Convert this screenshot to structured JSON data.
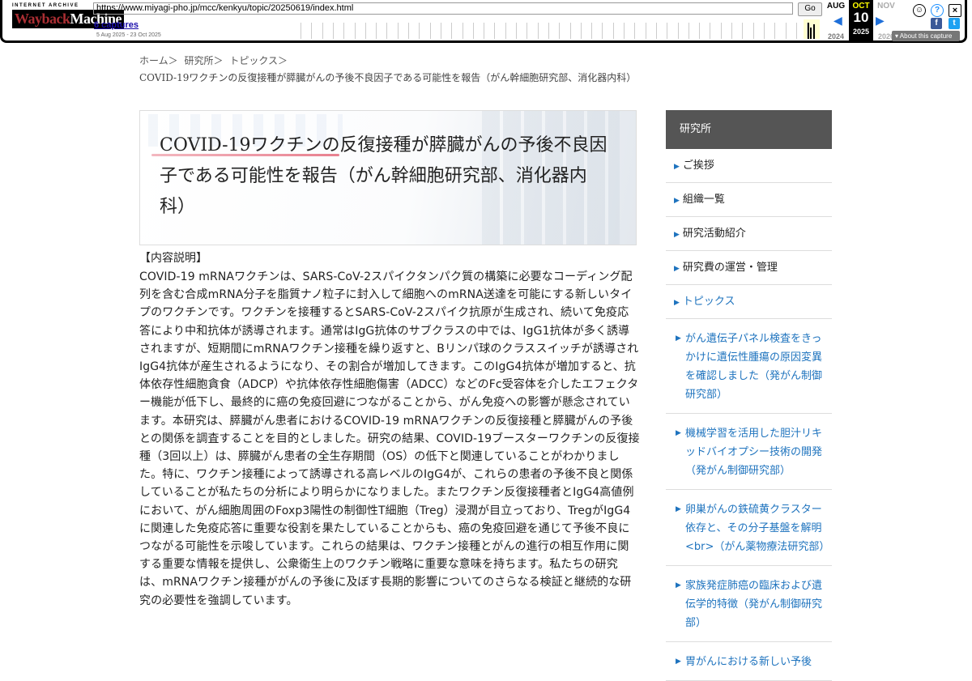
{
  "wayback": {
    "logo_small": "INTERNET ARCHIVE",
    "logo_big_1": "Wayback",
    "logo_big_2": "Machine",
    "url": "https://www.miyagi-pho.jp/mcc/kenkyu/topic/20250619/index.html",
    "go_label": "Go",
    "captures": "6 captures",
    "range": "5 Aug 2025 - 23 Oct 2025",
    "prev": {
      "month": "AUG",
      "year": "2024"
    },
    "current": {
      "month": "OCT",
      "day": "10",
      "year": "2025"
    },
    "next": {
      "month": "NOV",
      "year": "2026"
    },
    "about": "About this capture"
  },
  "breadcrumb": [
    "ホーム＞",
    "研究所＞",
    "トピックス＞"
  ],
  "subtitle": "COVID-19ワクチンの反復接種が膵臓がんの予後不良因子である可能性を報告（がん幹細胞研究部、消化器内科）",
  "hero": {
    "title": "COVID-19ワクチンの反復接種が膵臓がんの予後不良因子である可能性を報告（がん幹細胞研究部、消化器内科）"
  },
  "content": {
    "heading": "【内容説明】",
    "body": "COVID-19 mRNAワクチンは、SARS-CoV-2スパイクタンパク質の構築に必要なコーディング配列を含む合成mRNA分子を脂質ナノ粒子に封入して細胞へのmRNA送達を可能にする新しいタイプのワクチンです。ワクチンを接種するとSARS-CoV-2スパイク抗原が生成され、続いて免疫応答により中和抗体が誘導されます。通常はIgG抗体のサブクラスの中では、IgG1抗体が多く誘導されますが、短期間にmRNAワクチン接種を繰り返すと、Bリンパ球のクラススイッチが誘導されIgG4抗体が産生されるようになり、その割合が増加してきます。このIgG4抗体が増加すると、抗体依存性細胞貪食（ADCP）や抗体依存性細胞傷害（ADCC）などのFc受容体を介したエフェクター機能が低下し、最終的に癌の免疫回避につながることから、がん免疫への影響が懸念されています。本研究は、膵臓がん患者におけるCOVID-19 mRNAワクチンの反復接種と膵臓がんの予後との関係を調査することを目的としました。研究の結果、COVID-19ブースターワクチンの反復接種（3回以上）は、膵臓がん患者の全生存期間（OS）の低下と関連していることがわかりました。特に、ワクチン接種によって誘導される高レベルのIgG4が、これらの患者の予後不良と関係していることが私たちの分析により明らかになりました。またワクチン反復接種者とIgG4高値例において、がん細胞周囲のFoxp3陽性の制御性T細胞（Treg）浸潤が目立っており、TregがIgG4に関連した免疫応答に重要な役割を果たしていることからも、癌の免疫回避を通じて予後不良につながる可能性を示唆しています。これらの結果は、ワクチン接種とがんの進行の相互作用に関する重要な情報を提供し、公衆衛生上のワクチン戦略に重要な意味を持ちます。私たちの研究は、mRNAワクチン接種ががんの予後に及ぼす長期的影響についてのさらなる検証と継続的な研究の必要性を強調しています。"
  },
  "sidebar": {
    "title": "研究所",
    "items": [
      {
        "label": "ご挨拶"
      },
      {
        "label": "組織一覧"
      },
      {
        "label": "研究活動紹介"
      },
      {
        "label": "研究費の運営・管理"
      },
      {
        "label": "トピックス"
      }
    ],
    "subitems": [
      {
        "label": "がん遺伝子パネル検査をきっかけに遺伝性腫瘍の原因変異を確認しました（発がん制御研究部）"
      },
      {
        "label": "機械学習を活用した胆汁リキッドバイオプシー技術の開発（発がん制御研究部）"
      },
      {
        "label": "卵巣がんの鉄硫黄クラスター依存と、その分子基盤を解明<br>（がん薬物療法研究部）"
      },
      {
        "label": "家族発症肺癌の臨床および遺伝学的特徴（発がん制御研究部）"
      },
      {
        "label": "胃がんにおける新しい予後"
      }
    ]
  }
}
